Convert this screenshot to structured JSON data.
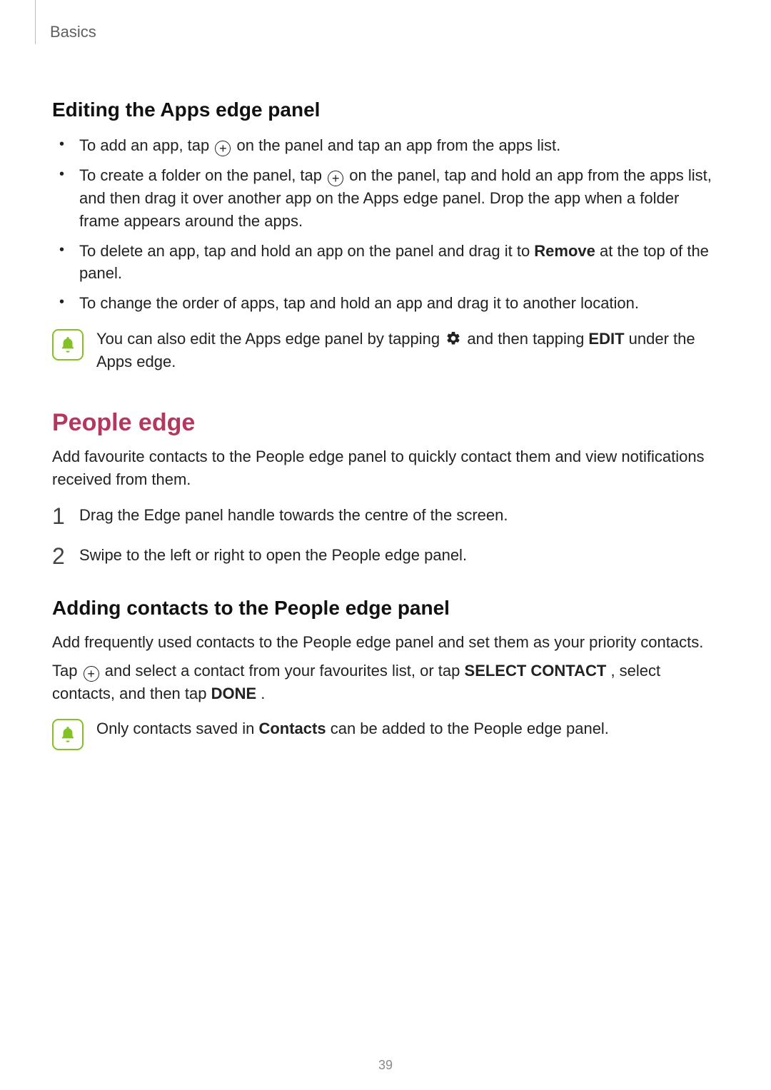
{
  "header": {
    "section_label": "Basics"
  },
  "page_number": "39",
  "h_editing": "Editing the Apps edge panel",
  "bullets": {
    "b1a": "To add an app, tap ",
    "b1b": " on the panel and tap an app from the apps list.",
    "b2a": "To create a folder on the panel, tap ",
    "b2b": " on the panel, tap and hold an app from the apps list, and then drag it over another app on the Apps edge panel. Drop the app when a folder frame appears around the apps.",
    "b3a": "To delete an app, tap and hold an app on the panel and drag it to ",
    "b3_bold": "Remove",
    "b3b": " at the top of the panel.",
    "b4": "To change the order of apps, tap and hold an app and drag it to another location."
  },
  "note1": {
    "a": "You can also edit the Apps edge panel by tapping ",
    "b": " and then tapping ",
    "bold": "EDIT",
    "c": " under the Apps edge."
  },
  "h_people": "People edge",
  "people_intro": "Add favourite contacts to the People edge panel to quickly contact them and view notifications received from them.",
  "steps": {
    "s1": "Drag the Edge panel handle towards the centre of the screen.",
    "s2": "Swipe to the left or right to open the People edge panel."
  },
  "h_adding": "Adding contacts to the People edge panel",
  "adding_p1": "Add frequently used contacts to the People edge panel and set them as your priority contacts.",
  "adding_p2a": "Tap ",
  "adding_p2b": " and select a contact from your favourites list, or tap ",
  "adding_p2_bold1": "SELECT CONTACT",
  "adding_p2c": ", select contacts, and then tap ",
  "adding_p2_bold2": "DONE",
  "adding_p2d": ".",
  "note2": {
    "a": "Only contacts saved in ",
    "bold": "Contacts",
    "b": " can be added to the People edge panel."
  }
}
